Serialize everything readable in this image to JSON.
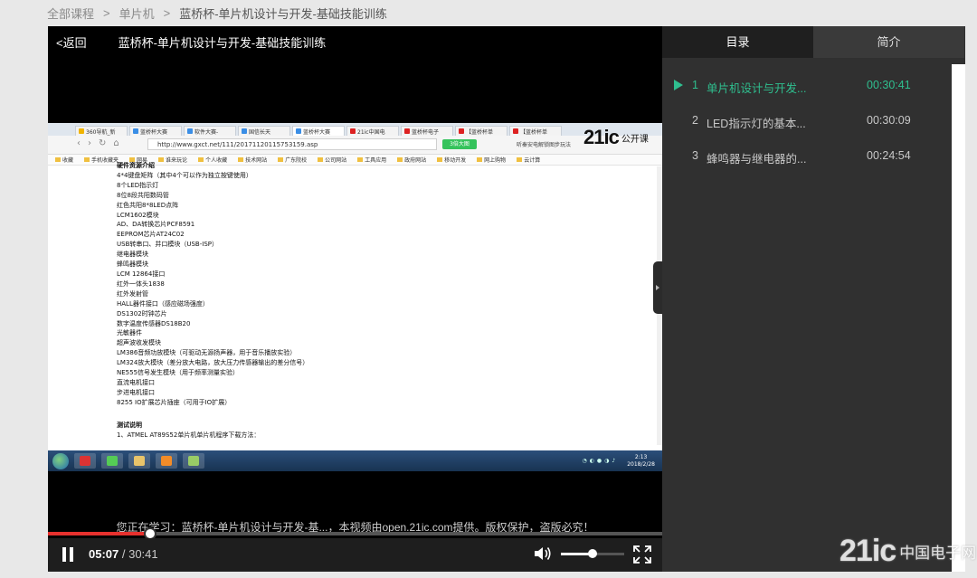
{
  "breadcrumb": {
    "items": [
      "全部课程",
      "单片机",
      "蓝桥杯-单片机设计与开发-基础技能训练"
    ],
    "separator": ">"
  },
  "player": {
    "back_label": "<返回",
    "title": "蓝桥杯-单片机设计与开发-基础技能训练",
    "notice": "您正在学习：蓝桥杯-单片机设计与开发-基...，本视频由open.21ic.com提供。版权保护，盗版必究！",
    "current_time": "05:07",
    "time_separator": " / ",
    "duration": "30:41",
    "progress_fraction": 0.167,
    "volume_fraction": 0.5,
    "accent_color": "#e7312e"
  },
  "screen": {
    "tabs": [
      "360导航_新",
      "蓝桥杯大赛",
      "软件大赛-",
      "国信长天",
      "蓝桥杯大赛",
      "21ic中国电",
      "蓝桥杯电子",
      "【蓝桥杯单",
      "【蓝桥杯单"
    ],
    "url": "http://www.gxct.net/111/20171120115753159.asp",
    "url_badge": "3倍大图",
    "addr_right": "听秦安电解锁图步玩法",
    "logo_num": "21ic",
    "logo_sub": "公开课",
    "bookmarks": [
      "收藏",
      "手机收藏夹",
      "网易",
      "谁来玩论",
      "个人收藏",
      "技术网站",
      "广东院校",
      "公司网站",
      "工具应用",
      "政府网站",
      "移动开发",
      "网上购物",
      "云计算"
    ],
    "lines": [
      "硬件资源介绍",
      "4*4键盘矩阵（其中4个可以作为独立按键使用）",
      "8个LED指示灯",
      "8位8段共阳数码管",
      "红色共阳8*8LED点阵",
      "LCM1602模块",
      "AD、DA转换芯片PCF8591",
      "EEPROM芯片AT24C02",
      "USB转串口、并口模块（USB-ISP）",
      "继电器模块",
      "蜂鸣器模块",
      "LCM 12864接口",
      "红外一体头1838",
      "红外发射管",
      "HALL器件接口（感应磁场强度）",
      "DS1302时钟芯片",
      "数字温度传感器DS18B20",
      "光敏器件",
      "超声波收发模块",
      "LM386音频功放模块（可驱动无源扬声器，用于音乐播放实验）",
      "LM324放大模块（差分放大电路，放大压力传感器输出的差分信号）",
      "NE555信号发生模块（用于频率测量实验）",
      "直流电机接口",
      "步进电机接口",
      "8255 IO扩展芯片插座（可用于IO扩展）"
    ],
    "section_title": "测试说明",
    "section_line": "1、ATMEL AT89S52单片机单片机程序下载方法：",
    "clock_time": "2:13",
    "clock_date": "2018/2/28"
  },
  "sidebar": {
    "tab_catalog": "目录",
    "tab_intro": "简介",
    "items": [
      {
        "index": "1",
        "title": "单片机设计与开发...",
        "duration": "00:30:41"
      },
      {
        "index": "2",
        "title": "LED指示灯的基本...",
        "duration": "00:30:09"
      },
      {
        "index": "3",
        "title": "蜂鸣器与继电器的...",
        "duration": "00:24:54"
      }
    ],
    "active_color": "#2fbf8f"
  },
  "watermark": {
    "num": "21ic",
    "cn": "中国电子网"
  }
}
